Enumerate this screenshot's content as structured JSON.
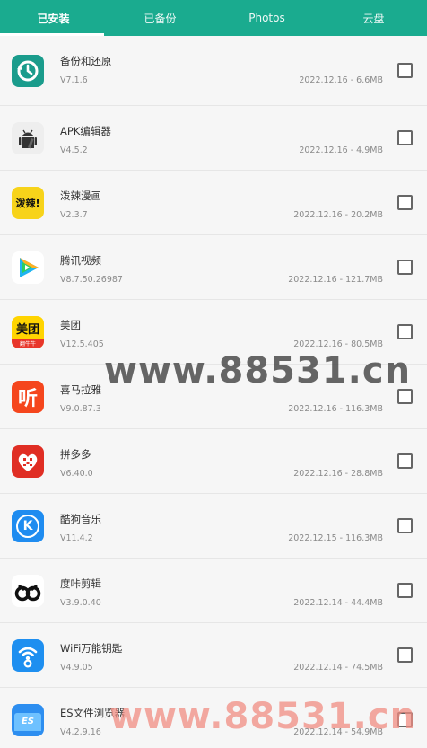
{
  "tabs": [
    {
      "label": "已安装",
      "active": true
    },
    {
      "label": "已备份",
      "active": false
    },
    {
      "label": "Photos",
      "active": false
    },
    {
      "label": "云盘",
      "active": false
    }
  ],
  "apps": [
    {
      "name": "备份和还原",
      "version": "V7.1.6",
      "meta": "2022.12.16 - 6.6MB",
      "icon": "backup-restore-icon",
      "color": "#1a9c8c"
    },
    {
      "name": "APK编辑器",
      "version": "V4.5.2",
      "meta": "2022.12.16 - 4.9MB",
      "icon": "apk-editor-icon",
      "color": "#eeeeee"
    },
    {
      "name": "泼辣漫画",
      "version": "V2.3.7",
      "meta": "2022.12.16 - 20.2MB",
      "icon": "pola-manga-icon",
      "color": "#f7d31a"
    },
    {
      "name": "腾讯视频",
      "version": "V8.7.50.26987",
      "meta": "2022.12.16 - 121.7MB",
      "icon": "tencent-video-icon",
      "color": "#ffffff"
    },
    {
      "name": "美团",
      "version": "V12.5.405",
      "meta": "2022.12.16 - 80.5MB",
      "icon": "meituan-icon",
      "color": "#ffd400"
    },
    {
      "name": "喜马拉雅",
      "version": "V9.0.87.3",
      "meta": "2022.12.16 - 116.3MB",
      "icon": "ximalaya-icon",
      "color": "#f5461d"
    },
    {
      "name": "拼多多",
      "version": "V6.40.0",
      "meta": "2022.12.16 - 28.8MB",
      "icon": "pinduoduo-icon",
      "color": "#e02e24"
    },
    {
      "name": "酷狗音乐",
      "version": "V11.4.2",
      "meta": "2022.12.15 - 116.3MB",
      "icon": "kugou-icon",
      "color": "#1f8cf0"
    },
    {
      "name": "度咔剪辑",
      "version": "V3.9.0.40",
      "meta": "2022.12.14 - 44.4MB",
      "icon": "duka-icon",
      "color": "#ffffff"
    },
    {
      "name": "WiFi万能钥匙",
      "version": "V4.9.05",
      "meta": "2022.12.14 - 74.5MB",
      "icon": "wifi-key-icon",
      "color": "#1e8ff0"
    },
    {
      "name": "ES文件浏览器",
      "version": "V4.2.9.16",
      "meta": "2022.12.14 - 54.9MB",
      "icon": "es-file-icon",
      "color": "#2d8ef0"
    }
  ],
  "icon_text": {
    "pola": "泼辣!",
    "meituan": "美团",
    "meituan_sub": "翻牛牛",
    "ximalaya": "听",
    "kugou": "K",
    "es": "ES"
  },
  "watermarks": [
    "www.88531.cn",
    "www.88531.cn"
  ]
}
